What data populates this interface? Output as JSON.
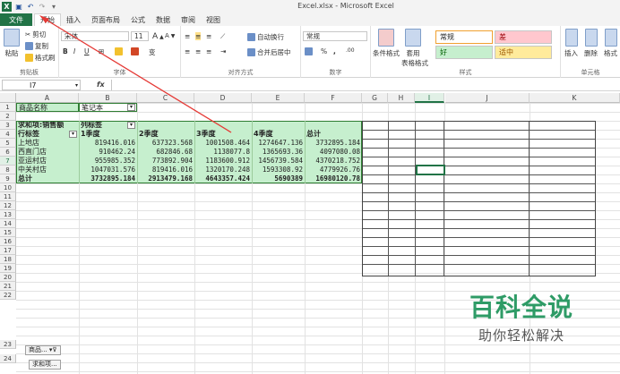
{
  "window": {
    "title": "Excel.xlsx - Microsoft Excel"
  },
  "qat": {
    "undo": "↶",
    "redo": "↷"
  },
  "tabs": [
    {
      "label": "文件",
      "key": "file"
    },
    {
      "label": "开始",
      "key": "home"
    },
    {
      "label": "插入",
      "key": "insert"
    },
    {
      "label": "页面布局",
      "key": "layout"
    },
    {
      "label": "公式",
      "key": "formula"
    },
    {
      "label": "数据",
      "key": "data"
    },
    {
      "label": "审阅",
      "key": "review"
    },
    {
      "label": "视图",
      "key": "view"
    }
  ],
  "ribbon": {
    "clipboard": {
      "paste": "粘贴",
      "cut": "剪切",
      "copy": "复制",
      "format_painter": "格式刷",
      "label": "剪贴板"
    },
    "font": {
      "name": "宋体",
      "size": "11",
      "grow": "A",
      "shrink": "A",
      "bold": "B",
      "italic": "I",
      "underline": "U",
      "wen": "变",
      "label": "字体"
    },
    "alignment": {
      "wrap": "自动换行",
      "merge": "合并后居中",
      "label": "对齐方式"
    },
    "number": {
      "format": "常规",
      "percent": "%",
      "comma": ",",
      "label": "数字"
    },
    "styles": {
      "conditional": "条件格式",
      "table": "套用",
      "table2": "表格格式",
      "cell_normal": "常规",
      "cell_bad": "差",
      "cell_good": "好",
      "cell_neutral": "适中",
      "label": "样式"
    },
    "cells": {
      "insert": "插入",
      "delete": "删除",
      "format": "格式",
      "label": "单元格"
    }
  },
  "formula_bar": {
    "name_box": "I7",
    "fx": "fx",
    "value": ""
  },
  "columns": [
    "A",
    "B",
    "C",
    "D",
    "E",
    "F",
    "G",
    "H",
    "I",
    "J",
    "K"
  ],
  "rows": [
    "1",
    "2",
    "3",
    "4",
    "5",
    "6",
    "7",
    "8",
    "9",
    "10",
    "11",
    "12",
    "13",
    "14",
    "15",
    "16",
    "17",
    "18",
    "19",
    "20",
    "21",
    "22",
    "23",
    "24"
  ],
  "pivot": {
    "filter_label": "商品名称",
    "filter_value": "笔记本",
    "sum_label": "求和项:销售额",
    "col_label": "列标签",
    "row_label": "行标签",
    "headers": [
      "1季度",
      "2季度",
      "3季度",
      "4季度",
      "总计"
    ],
    "rows": [
      {
        "name": "上地店",
        "values": [
          "819416.016",
          "637323.568",
          "1001508.464",
          "1274647.136",
          "3732895.184"
        ]
      },
      {
        "name": "西直门店",
        "values": [
          "910462.24",
          "682846.68",
          "1138077.8",
          "1365693.36",
          "4097080.08"
        ]
      },
      {
        "name": "亚运村店",
        "values": [
          "955985.352",
          "773892.904",
          "1183600.912",
          "1456739.584",
          "4370218.752"
        ]
      },
      {
        "name": "中关村店",
        "values": [
          "1047031.576",
          "819416.016",
          "1320170.248",
          "1593308.92",
          "4779926.76"
        ]
      }
    ],
    "total": {
      "name": "总计",
      "values": [
        "3732895.184",
        "2913479.168",
        "4643357.424",
        "5690389",
        "16980120.78"
      ]
    }
  },
  "field_buttons": {
    "product": "商品...",
    "sum": "求和项..."
  },
  "watermark": {
    "title": "百科全说",
    "subtitle": "助你轻松解决"
  }
}
